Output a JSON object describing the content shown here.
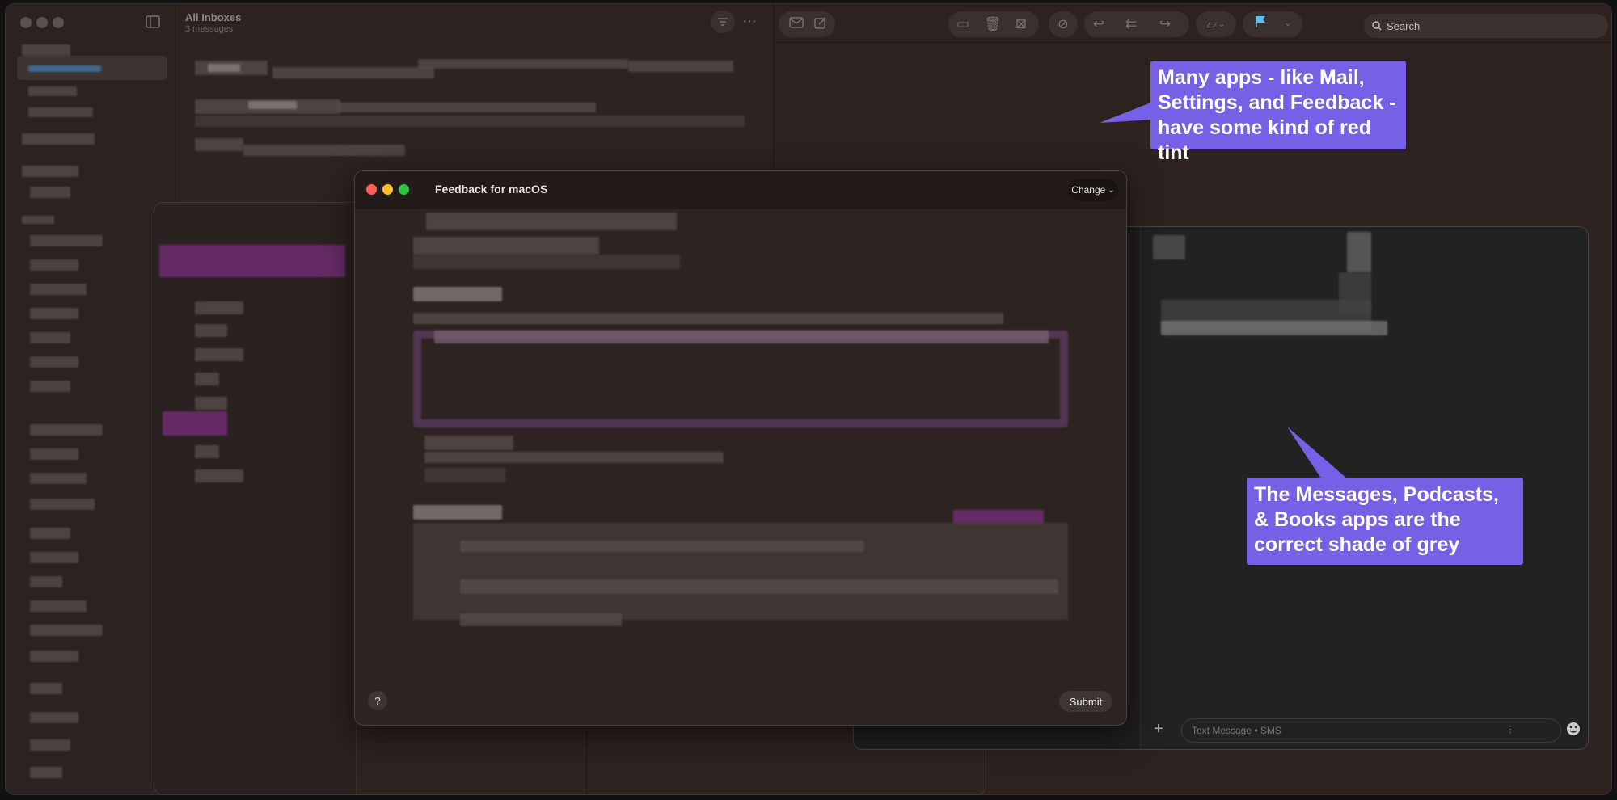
{
  "mail": {
    "list_title": "All Inboxes",
    "list_subtitle": "3 messages",
    "search_placeholder": "Search",
    "icons": [
      "sidebar-icon",
      "filter-icon",
      "more-icon",
      "envelope-icon",
      "compose-icon",
      "archive-icon",
      "trash-icon",
      "junk-icon",
      "mute-icon",
      "reply-icon",
      "reply-all-icon",
      "forward-icon",
      "folder-icon",
      "flag-icon",
      "chevron-down-icon",
      "search-icon"
    ],
    "flag_color": "#4fc3f7"
  },
  "feedback": {
    "title": "Feedback for macOS",
    "change_label": "Change",
    "help_label": "?",
    "submit_label": "Submit"
  },
  "messages": {
    "input_placeholder": "Text Message • SMS",
    "add_label": "+"
  },
  "annotations": {
    "callout1": "Many apps - like Mail, Settings, and Feedback - have some kind of red tint",
    "callout2": "The Messages, Podcasts, & Books apps are the correct shade of grey",
    "color": "#7560e6"
  }
}
